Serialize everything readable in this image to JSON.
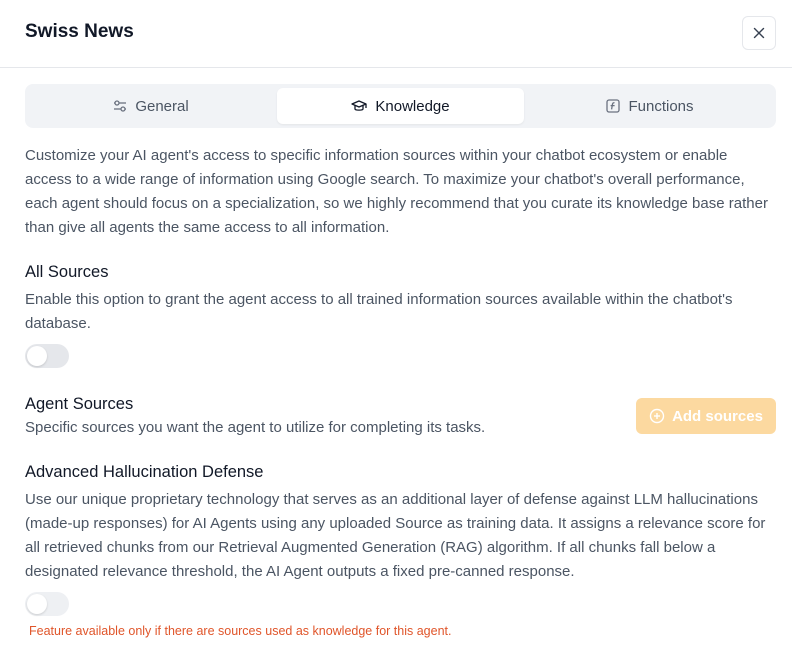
{
  "dialog": {
    "title": "Swiss News",
    "close_icon": "close-icon"
  },
  "tabs": [
    {
      "label": "General",
      "icon": "sliders-icon",
      "active": false
    },
    {
      "label": "Knowledge",
      "icon": "graduation-cap-icon",
      "active": true
    },
    {
      "label": "Functions",
      "icon": "function-icon",
      "active": false
    }
  ],
  "intro": {
    "lines": [
      "Customize your AI agent's access to specific information sources within your chatbot ecosystem or enable",
      "access to a wide range of information using Google search. To maximize your chatbot's overall performance,",
      "each agent should focus on a specialization, so we highly recommend that you curate its knowledge base rather",
      "than give all agents the same access to all information."
    ]
  },
  "all_sources": {
    "heading": "All Sources",
    "lines": [
      "Enable this option to grant the agent access to all trained information sources available within the chatbot's",
      "database."
    ],
    "enabled": false
  },
  "agent_sources": {
    "heading": "Agent Sources",
    "description": "Specific sources you want the agent to utilize for completing its tasks.",
    "add_button_label": "Add sources",
    "add_button_icon": "plus-circle-icon"
  },
  "hallucination": {
    "heading": "Advanced Hallucination Defense",
    "lines": [
      "Use our unique proprietary technology that serves as an additional layer of defense against LLM hallucinations",
      "(made-up responses) for AI Agents using any uploaded Source as training data. It assigns a relevance score for",
      "all retrieved chunks from our Retrieval Augmented Generation (RAG) algorithm. If all chunks fall below a",
      "designated relevance threshold, the AI Agent outputs a fixed pre-canned response."
    ],
    "enabled": false,
    "warning": "Feature available only if there are sources used as knowledge for this agent."
  },
  "colors": {
    "accent_disabled": "#fcd9a0",
    "warning": "#e0552a"
  }
}
